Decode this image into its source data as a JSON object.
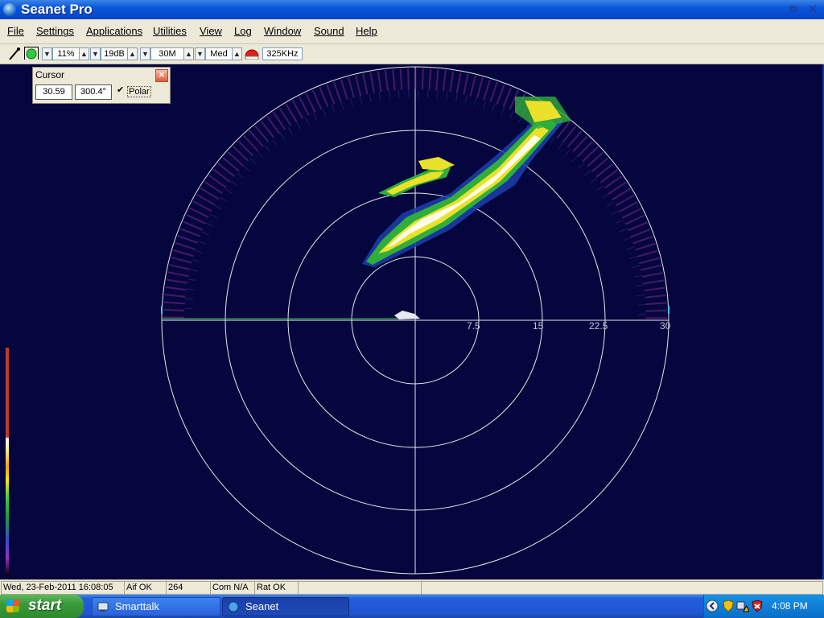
{
  "window": {
    "title": "Seanet Pro"
  },
  "menu": [
    "File",
    "Settings",
    "Applications",
    "Utilities",
    "View",
    "Log",
    "Window",
    "Sound",
    "Help"
  ],
  "toolbar": {
    "gain": "11%",
    "contrast": "19dB",
    "range": "30M",
    "resolution": "Med",
    "frequency": "325KHz"
  },
  "cursor_panel": {
    "title": "Cursor",
    "distance": "30.59",
    "bearing": "300.4°",
    "polar_label": "Polar",
    "polar_checked": true
  },
  "sonar": {
    "range_labels": [
      "7.5",
      "15",
      "22.5",
      "30"
    ]
  },
  "status": {
    "datetime": "Wed, 23-Feb-2011 16:08:05",
    "aif": "Aif OK",
    "count": "264",
    "com": "Com N/A",
    "rat": "Rat OK"
  },
  "taskbar": {
    "start_label": "start",
    "tasks": [
      "Smarttalk",
      "Seanet"
    ],
    "clock": "4:08 PM"
  },
  "colors": {
    "sonar_background": "#05063e",
    "titlebar": "#0a56d9",
    "taskbar": "#245edb"
  }
}
